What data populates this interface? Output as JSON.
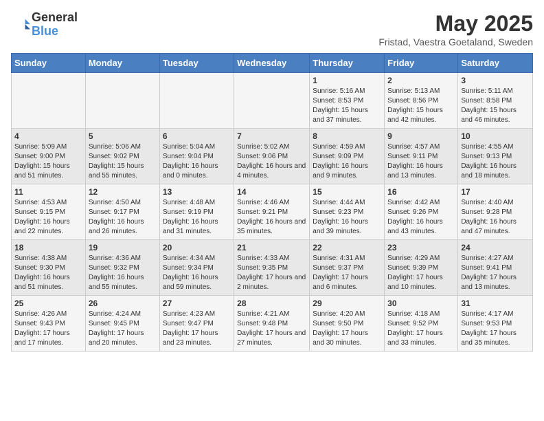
{
  "header": {
    "logo_line1": "General",
    "logo_line2": "Blue",
    "month_title": "May 2025",
    "location": "Fristad, Vaestra Goetaland, Sweden"
  },
  "days_of_week": [
    "Sunday",
    "Monday",
    "Tuesday",
    "Wednesday",
    "Thursday",
    "Friday",
    "Saturday"
  ],
  "weeks": [
    [
      {
        "day": "",
        "info": ""
      },
      {
        "day": "",
        "info": ""
      },
      {
        "day": "",
        "info": ""
      },
      {
        "day": "",
        "info": ""
      },
      {
        "day": "1",
        "info": "Sunrise: 5:16 AM\nSunset: 8:53 PM\nDaylight: 15 hours\nand 37 minutes."
      },
      {
        "day": "2",
        "info": "Sunrise: 5:13 AM\nSunset: 8:56 PM\nDaylight: 15 hours\nand 42 minutes."
      },
      {
        "day": "3",
        "info": "Sunrise: 5:11 AM\nSunset: 8:58 PM\nDaylight: 15 hours\nand 46 minutes."
      }
    ],
    [
      {
        "day": "4",
        "info": "Sunrise: 5:09 AM\nSunset: 9:00 PM\nDaylight: 15 hours\nand 51 minutes."
      },
      {
        "day": "5",
        "info": "Sunrise: 5:06 AM\nSunset: 9:02 PM\nDaylight: 15 hours\nand 55 minutes."
      },
      {
        "day": "6",
        "info": "Sunrise: 5:04 AM\nSunset: 9:04 PM\nDaylight: 16 hours\nand 0 minutes."
      },
      {
        "day": "7",
        "info": "Sunrise: 5:02 AM\nSunset: 9:06 PM\nDaylight: 16 hours\nand 4 minutes."
      },
      {
        "day": "8",
        "info": "Sunrise: 4:59 AM\nSunset: 9:09 PM\nDaylight: 16 hours\nand 9 minutes."
      },
      {
        "day": "9",
        "info": "Sunrise: 4:57 AM\nSunset: 9:11 PM\nDaylight: 16 hours\nand 13 minutes."
      },
      {
        "day": "10",
        "info": "Sunrise: 4:55 AM\nSunset: 9:13 PM\nDaylight: 16 hours\nand 18 minutes."
      }
    ],
    [
      {
        "day": "11",
        "info": "Sunrise: 4:53 AM\nSunset: 9:15 PM\nDaylight: 16 hours\nand 22 minutes."
      },
      {
        "day": "12",
        "info": "Sunrise: 4:50 AM\nSunset: 9:17 PM\nDaylight: 16 hours\nand 26 minutes."
      },
      {
        "day": "13",
        "info": "Sunrise: 4:48 AM\nSunset: 9:19 PM\nDaylight: 16 hours\nand 31 minutes."
      },
      {
        "day": "14",
        "info": "Sunrise: 4:46 AM\nSunset: 9:21 PM\nDaylight: 16 hours\nand 35 minutes."
      },
      {
        "day": "15",
        "info": "Sunrise: 4:44 AM\nSunset: 9:23 PM\nDaylight: 16 hours\nand 39 minutes."
      },
      {
        "day": "16",
        "info": "Sunrise: 4:42 AM\nSunset: 9:26 PM\nDaylight: 16 hours\nand 43 minutes."
      },
      {
        "day": "17",
        "info": "Sunrise: 4:40 AM\nSunset: 9:28 PM\nDaylight: 16 hours\nand 47 minutes."
      }
    ],
    [
      {
        "day": "18",
        "info": "Sunrise: 4:38 AM\nSunset: 9:30 PM\nDaylight: 16 hours\nand 51 minutes."
      },
      {
        "day": "19",
        "info": "Sunrise: 4:36 AM\nSunset: 9:32 PM\nDaylight: 16 hours\nand 55 minutes."
      },
      {
        "day": "20",
        "info": "Sunrise: 4:34 AM\nSunset: 9:34 PM\nDaylight: 16 hours\nand 59 minutes."
      },
      {
        "day": "21",
        "info": "Sunrise: 4:33 AM\nSunset: 9:35 PM\nDaylight: 17 hours\nand 2 minutes."
      },
      {
        "day": "22",
        "info": "Sunrise: 4:31 AM\nSunset: 9:37 PM\nDaylight: 17 hours\nand 6 minutes."
      },
      {
        "day": "23",
        "info": "Sunrise: 4:29 AM\nSunset: 9:39 PM\nDaylight: 17 hours\nand 10 minutes."
      },
      {
        "day": "24",
        "info": "Sunrise: 4:27 AM\nSunset: 9:41 PM\nDaylight: 17 hours\nand 13 minutes."
      }
    ],
    [
      {
        "day": "25",
        "info": "Sunrise: 4:26 AM\nSunset: 9:43 PM\nDaylight: 17 hours\nand 17 minutes."
      },
      {
        "day": "26",
        "info": "Sunrise: 4:24 AM\nSunset: 9:45 PM\nDaylight: 17 hours\nand 20 minutes."
      },
      {
        "day": "27",
        "info": "Sunrise: 4:23 AM\nSunset: 9:47 PM\nDaylight: 17 hours\nand 23 minutes."
      },
      {
        "day": "28",
        "info": "Sunrise: 4:21 AM\nSunset: 9:48 PM\nDaylight: 17 hours\nand 27 minutes."
      },
      {
        "day": "29",
        "info": "Sunrise: 4:20 AM\nSunset: 9:50 PM\nDaylight: 17 hours\nand 30 minutes."
      },
      {
        "day": "30",
        "info": "Sunrise: 4:18 AM\nSunset: 9:52 PM\nDaylight: 17 hours\nand 33 minutes."
      },
      {
        "day": "31",
        "info": "Sunrise: 4:17 AM\nSunset: 9:53 PM\nDaylight: 17 hours\nand 35 minutes."
      }
    ]
  ]
}
